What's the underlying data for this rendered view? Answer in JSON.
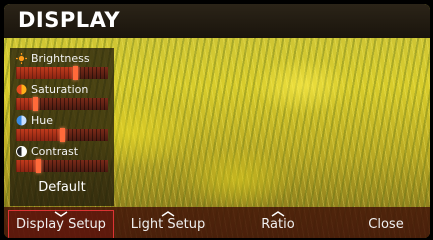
{
  "title": "DISPLAY",
  "settings": [
    {
      "label": "Brightness",
      "icon": "sun-icon",
      "level": 0.62
    },
    {
      "label": "Saturation",
      "icon": "saturation-icon",
      "level": 0.18
    },
    {
      "label": "Hue",
      "icon": "hue-icon",
      "level": 0.48
    },
    {
      "label": "Contrast",
      "icon": "contrast-icon",
      "level": 0.22
    }
  ],
  "default_label": "Default",
  "bottom": {
    "display_setup": "Display Setup",
    "light_setup": "Light Setup",
    "ratio": "Ratio",
    "close": "Close"
  },
  "colors": {
    "accent": "#d33333",
    "fill": "#c23a1c"
  }
}
